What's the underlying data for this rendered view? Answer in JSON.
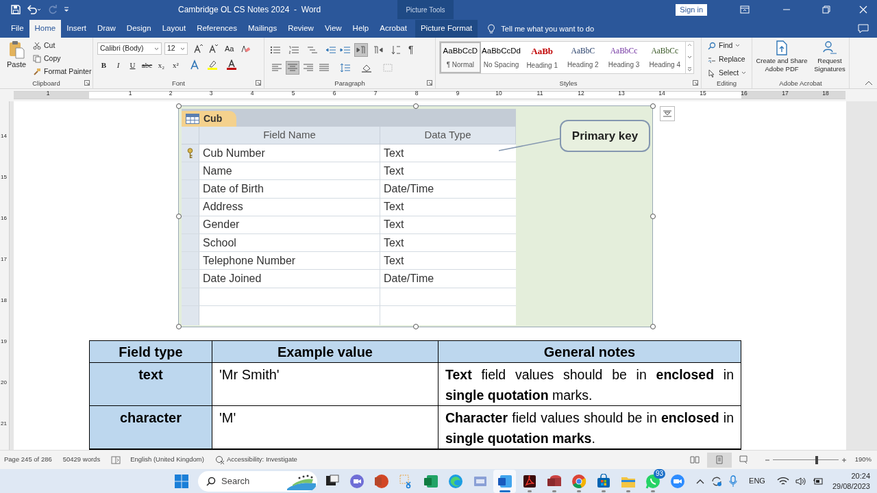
{
  "window": {
    "title": "Cambridge OL CS Notes 2024  -  Word",
    "contextual_header": "Picture Tools",
    "sign_in": "Sign in"
  },
  "ribbon_tabs": [
    {
      "label": "File",
      "selected": false,
      "contextual": false
    },
    {
      "label": "Home",
      "selected": true,
      "contextual": false
    },
    {
      "label": "Insert",
      "selected": false,
      "contextual": false
    },
    {
      "label": "Draw",
      "selected": false,
      "contextual": false
    },
    {
      "label": "Design",
      "selected": false,
      "contextual": false
    },
    {
      "label": "Layout",
      "selected": false,
      "contextual": false
    },
    {
      "label": "References",
      "selected": false,
      "contextual": false
    },
    {
      "label": "Mailings",
      "selected": false,
      "contextual": false
    },
    {
      "label": "Review",
      "selected": false,
      "contextual": false
    },
    {
      "label": "View",
      "selected": false,
      "contextual": false
    },
    {
      "label": "Help",
      "selected": false,
      "contextual": false
    },
    {
      "label": "Acrobat",
      "selected": false,
      "contextual": false
    },
    {
      "label": "Picture Format",
      "selected": false,
      "contextual": true
    }
  ],
  "tell_me": {
    "placeholder": "Tell me what you want to do"
  },
  "clipboard": {
    "label": "Clipboard",
    "paste": "Paste",
    "commands": [
      "Cut",
      "Copy",
      "Format Painter"
    ]
  },
  "font": {
    "label": "Font",
    "font_name": "Calibri (Body)",
    "font_size": "12",
    "change_case": "Aa",
    "format_buttons": [
      "B",
      "I",
      "U",
      "abc",
      "x₂",
      "x²"
    ]
  },
  "paragraph": {
    "label": "Paragraph",
    "show_marks": "¶",
    "text_direction": [
      {
        "selected": true
      },
      {
        "selected": false
      }
    ],
    "alignment": [
      {
        "selected": false
      },
      {
        "selected": true
      },
      {
        "selected": false
      },
      {
        "selected": false
      }
    ]
  },
  "styles": {
    "label": "Styles",
    "items": [
      {
        "preview": "AaBbCcD",
        "name": "¶ Normal",
        "selected": true,
        "color": "#000000"
      },
      {
        "preview": "AaBbCcDd",
        "name": "No Spacing",
        "selected": false,
        "color": "#000000"
      },
      {
        "preview": "AaBb",
        "name": "Heading 1",
        "selected": false,
        "color": "#c00000"
      },
      {
        "preview": "AaBbC",
        "name": "Heading 2",
        "selected": false,
        "color": "#1f3864"
      },
      {
        "preview": "AaBbCc",
        "name": "Heading 3",
        "selected": false,
        "color": "#7030a0"
      },
      {
        "preview": "AaBbCc",
        "name": "Heading 4",
        "selected": false,
        "color": "#375623"
      }
    ]
  },
  "editing": {
    "label": "Editing",
    "commands": [
      "Find",
      "Replace",
      "Select"
    ]
  },
  "acrobat": {
    "label": "Adobe Acrobat",
    "buttons": [
      "Create and Share Adobe PDF",
      "Request Signatures"
    ]
  },
  "ruler": {
    "horizontal": [
      "1",
      "1",
      "2",
      "3",
      "4",
      "5",
      "6",
      "7",
      "8",
      "9",
      "10",
      "11",
      "12",
      "13",
      "14",
      "15",
      "16",
      "17",
      "18"
    ],
    "vertical": [
      "14",
      "15",
      "16",
      "17",
      "18",
      "19",
      "20",
      "21"
    ]
  },
  "picture": {
    "table_name": "Cub",
    "columns": [
      "Field Name",
      "Data Type"
    ],
    "callout": "Primary key",
    "rows": [
      {
        "field_name": "Cub Number",
        "data_type": "Text",
        "primary_key": true
      },
      {
        "field_name": "Name",
        "data_type": "Text",
        "primary_key": false
      },
      {
        "field_name": "Date of Birth",
        "data_type": "Date/Time",
        "primary_key": false
      },
      {
        "field_name": "Address",
        "data_type": "Text",
        "primary_key": false
      },
      {
        "field_name": "Gender",
        "data_type": "Text",
        "primary_key": false
      },
      {
        "field_name": "School",
        "data_type": "Text",
        "primary_key": false
      },
      {
        "field_name": "Telephone Number",
        "data_type": "Text",
        "primary_key": false
      },
      {
        "field_name": "Date Joined",
        "data_type": "Date/Time",
        "primary_key": false
      }
    ]
  },
  "table": {
    "columns": [
      "Field type",
      "Example value",
      "General notes"
    ],
    "rows": [
      {
        "field_type": "text",
        "example": "'Mr Smith'",
        "notes": "**Text** field values should be in **enclosed** in **single quotation** marks."
      },
      {
        "field_type": "character",
        "example": "'M'",
        "notes": "**Character** field values should be in **enclosed** in **single quotation marks**."
      }
    ]
  },
  "status_bar": {
    "page": "Page 245 of 286",
    "words": "50429 words",
    "language": "English (United Kingdom)",
    "accessibility": "Accessibility: Investigate",
    "views": [
      {
        "selected": false
      },
      {
        "selected": true
      },
      {
        "selected": false
      }
    ],
    "zoom": {
      "level": 0.67,
      "reading": "190%"
    }
  },
  "taskbar": {
    "search": {
      "placeholder": "Search"
    },
    "apps": [
      {
        "running": false,
        "active": false
      },
      {
        "running": false,
        "active": false
      },
      {
        "running": false,
        "active": false
      },
      {
        "running": false,
        "active": false
      },
      {
        "running": false,
        "active": false
      },
      {
        "running": false,
        "active": false
      },
      {
        "running": false,
        "active": false
      },
      {
        "running": true,
        "active": true
      },
      {
        "running": true,
        "active": false
      },
      {
        "running": true,
        "active": false
      },
      {
        "running": true,
        "active": false
      },
      {
        "running": true,
        "active": false
      },
      {
        "running": true,
        "active": false
      },
      {
        "running": true,
        "active": false,
        "badge": "93"
      },
      {
        "running": false,
        "active": false
      }
    ],
    "tray": {
      "language": "ENG",
      "time": "20:24",
      "date": "29/08/2023"
    }
  }
}
